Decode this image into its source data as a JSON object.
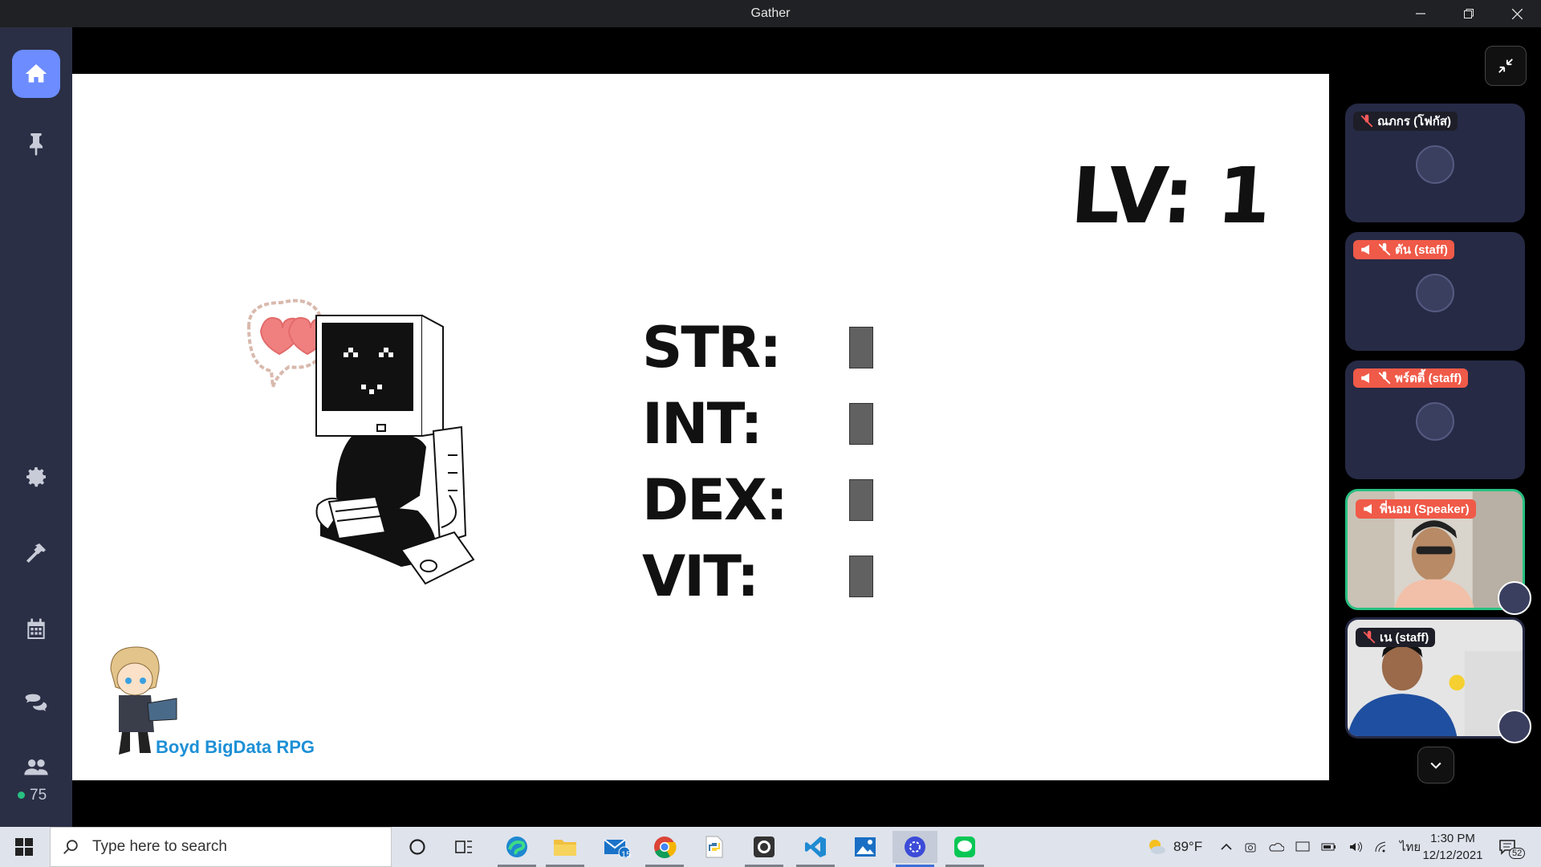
{
  "window": {
    "title": "Gather"
  },
  "sidebar": {
    "online_count": "75"
  },
  "slide": {
    "level_text": "LV: 1",
    "stats": [
      {
        "label": "STR:"
      },
      {
        "label": "INT:"
      },
      {
        "label": "DEX:"
      },
      {
        "label": "VIT:"
      }
    ],
    "brand_text": "Boyd BigData RPG"
  },
  "participants": [
    {
      "name": "ณภกร (โฟกัส)",
      "speaker": false,
      "muted": true,
      "video": false
    },
    {
      "name": "ตัน (staff)",
      "speaker": true,
      "muted": true,
      "video": false
    },
    {
      "name": "พร์ตตี้ (staff)",
      "speaker": true,
      "muted": true,
      "video": false
    },
    {
      "name": "พี่นอม (Speaker)",
      "speaker": true,
      "muted": false,
      "video": true
    },
    {
      "name": "เน (staff)",
      "speaker": false,
      "muted": true,
      "video": true
    }
  ],
  "taskbar": {
    "search_placeholder": "Type here to search",
    "mail_badge": "15",
    "weather": "89°F",
    "language": "ไทย",
    "time": "1:30 PM",
    "date": "12/12/2021",
    "notification_count": "52"
  },
  "colors": {
    "accent": "#6c8cff",
    "speaker_tag": "#f05a48",
    "sidebar": "#2b2f45",
    "active_border": "#27c080",
    "brand": "#1e90d6"
  }
}
